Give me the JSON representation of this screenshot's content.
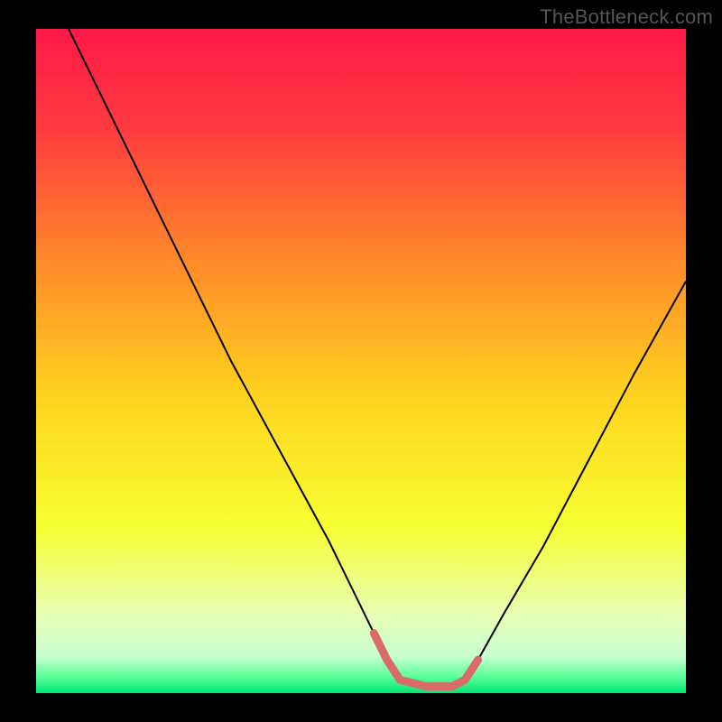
{
  "watermark": "TheBottleneck.com",
  "chart_data": {
    "type": "line",
    "title": "",
    "xlabel": "",
    "ylabel": "",
    "xlim": [
      0,
      100
    ],
    "ylim": [
      0,
      100
    ],
    "gradient_stops": [
      {
        "offset": 0.0,
        "color": "#ff1848"
      },
      {
        "offset": 0.15,
        "color": "#ff3b3f"
      },
      {
        "offset": 0.35,
        "color": "#ff8a2a"
      },
      {
        "offset": 0.55,
        "color": "#ffd21f"
      },
      {
        "offset": 0.75,
        "color": "#f7ff33"
      },
      {
        "offset": 0.88,
        "color": "#e9ffb3"
      },
      {
        "offset": 0.945,
        "color": "#c8ffd0"
      },
      {
        "offset": 0.975,
        "color": "#5aff98"
      },
      {
        "offset": 1.0,
        "color": "#00e676"
      }
    ],
    "series": [
      {
        "name": "bottleneck-curve",
        "stroke": "#000000",
        "stroke_width": 2,
        "x": [
          5,
          10,
          15,
          20,
          25,
          30,
          35,
          40,
          45,
          50,
          52,
          54,
          56,
          60,
          64,
          66,
          68,
          72,
          78,
          85,
          92,
          100
        ],
        "y": [
          100,
          90,
          80,
          70,
          60,
          50,
          41,
          32,
          23,
          13,
          9,
          5,
          2,
          1,
          1,
          2,
          5,
          12,
          22,
          35,
          48,
          62
        ]
      },
      {
        "name": "optimal-range",
        "stroke": "#d96b69",
        "stroke_width": 9,
        "x": [
          52,
          54,
          56,
          60,
          64,
          66,
          68
        ],
        "y": [
          9,
          5,
          2,
          1,
          1,
          2,
          5
        ]
      }
    ]
  }
}
